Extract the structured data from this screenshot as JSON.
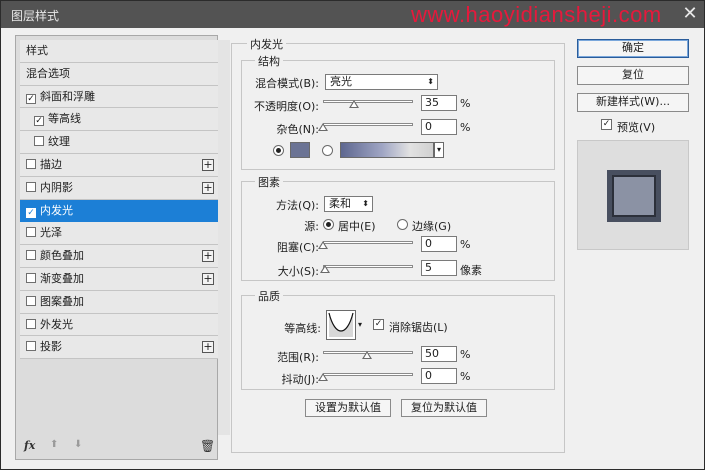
{
  "window": {
    "title": "图层样式",
    "watermark": "www.haoyidiansheji.com",
    "close_glyph": "✕"
  },
  "styles_list": {
    "items": [
      {
        "label": "样式",
        "checkbox": false,
        "checked": false,
        "plus": false,
        "selected": false
      },
      {
        "label": "混合选项",
        "checkbox": false,
        "checked": false,
        "plus": false,
        "selected": false
      },
      {
        "label": "斜面和浮雕",
        "checkbox": true,
        "checked": true,
        "plus": false,
        "selected": false
      },
      {
        "label": "等高线",
        "checkbox": true,
        "checked": true,
        "plus": false,
        "selected": false,
        "sub": true
      },
      {
        "label": "纹理",
        "checkbox": true,
        "checked": false,
        "plus": false,
        "selected": false,
        "sub": true
      },
      {
        "label": "描边",
        "checkbox": true,
        "checked": false,
        "plus": true,
        "selected": false
      },
      {
        "label": "内阴影",
        "checkbox": true,
        "checked": false,
        "plus": true,
        "selected": false
      },
      {
        "label": "内发光",
        "checkbox": true,
        "checked": true,
        "plus": false,
        "selected": true
      },
      {
        "label": "光泽",
        "checkbox": true,
        "checked": false,
        "plus": false,
        "selected": false
      },
      {
        "label": "颜色叠加",
        "checkbox": true,
        "checked": false,
        "plus": true,
        "selected": false
      },
      {
        "label": "渐变叠加",
        "checkbox": true,
        "checked": false,
        "plus": true,
        "selected": false
      },
      {
        "label": "图案叠加",
        "checkbox": true,
        "checked": false,
        "plus": false,
        "selected": false
      },
      {
        "label": "外发光",
        "checkbox": true,
        "checked": false,
        "plus": false,
        "selected": false
      },
      {
        "label": "投影",
        "checkbox": true,
        "checked": false,
        "plus": true,
        "selected": false
      }
    ],
    "footer": {
      "fx": "fx",
      "up_icon": "⬆",
      "down_icon": "⬇",
      "trash_icon": "🗑"
    }
  },
  "panel": {
    "title": "内发光",
    "structure": {
      "title": "结构",
      "blend_mode_label": "混合模式(B):",
      "blend_mode_value": "亮光",
      "opacity_label": "不透明度(O):",
      "opacity_value": "35",
      "opacity_fraction": 0.35,
      "noise_label": "杂色(N):",
      "noise_value": "0",
      "noise_fraction": 0,
      "percent": "%",
      "glow_color": "#6b7394"
    },
    "elements": {
      "title": "图素",
      "method_label": "方法(Q):",
      "method_value": "柔和",
      "source_label": "源:",
      "source_center": "居中(E)",
      "source_edge": "边缘(G)",
      "source_selected": "center",
      "choke_label": "阻塞(C):",
      "choke_value": "0",
      "choke_fraction": 0,
      "size_label": "大小(S):",
      "size_value": "5",
      "size_fraction": 0.02,
      "size_unit": "像素",
      "percent": "%"
    },
    "quality": {
      "title": "品质",
      "contour_label": "等高线:",
      "anti_alias_label": "消除锯齿(L)",
      "anti_alias_checked": true,
      "range_label": "范围(R):",
      "range_value": "50",
      "range_fraction": 0.5,
      "jitter_label": "抖动(J):",
      "jitter_value": "0",
      "jitter_fraction": 0,
      "percent": "%"
    },
    "buttons": {
      "make_default": "设置为默认值",
      "reset_default": "复位为默认值"
    }
  },
  "actions": {
    "ok": "确定",
    "reset": "复位",
    "new_style": "新建样式(W)...",
    "preview_label": "预览(V)",
    "preview_checked": true
  }
}
